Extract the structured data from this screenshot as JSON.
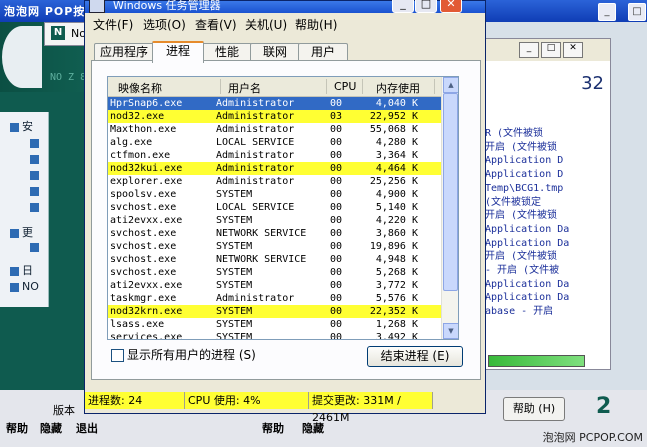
{
  "background": {
    "top_title": "泡泡网 POP按",
    "nod_window_title": "No",
    "left_items": [
      "安",
      "",
      "",
      "",
      "",
      "",
      "更",
      "",
      "日",
      "NO"
    ],
    "right_lines": [
      "R  (文件被锁",
      "开启 (文件被锁",
      "Application D",
      "Application D",
      "Temp\\BCG1.tmp",
      "(文件被锁定",
      "开启 (文件被锁",
      "Application Da",
      "Application Da",
      "开启 (文件被锁",
      "- 开启 (文件被",
      "Application Da",
      "Application Da",
      "abase - 开启"
    ],
    "right_number": "32",
    "version_label": "版本",
    "help_button": "帮助 (H)",
    "bottom_left_labels": [
      "帮助",
      "隐藏",
      "退出"
    ],
    "bottom_mid_labels": [
      "帮助",
      "隐藏"
    ],
    "watermark": "泡泡网 PCPOP.COM"
  },
  "taskmanager": {
    "title": "Windows 任务管理器",
    "menu": [
      "文件(F)",
      "选项(O)",
      "查看(V)",
      "关机(U)",
      "帮助(H)"
    ],
    "tabs": [
      "应用程序",
      "进程",
      "性能",
      "联网",
      "用户"
    ],
    "active_tab": "进程",
    "columns": [
      "映像名称",
      "用户名",
      "CPU",
      "内存使用"
    ],
    "processes": [
      {
        "name": "HprSnap6.exe",
        "user": "Administrator",
        "cpu": "00",
        "mem": "4,040 K",
        "state": "selected"
      },
      {
        "name": "nod32.exe",
        "user": "Administrator",
        "cpu": "03",
        "mem": "22,952 K",
        "state": "highlight"
      },
      {
        "name": "Maxthon.exe",
        "user": "Administrator",
        "cpu": "00",
        "mem": "55,068 K",
        "state": ""
      },
      {
        "name": "alg.exe",
        "user": "LOCAL SERVICE",
        "cpu": "00",
        "mem": "4,280 K",
        "state": ""
      },
      {
        "name": "ctfmon.exe",
        "user": "Administrator",
        "cpu": "00",
        "mem": "3,364 K",
        "state": ""
      },
      {
        "name": "nod32kui.exe",
        "user": "Administrator",
        "cpu": "00",
        "mem": "4,464 K",
        "state": "highlight"
      },
      {
        "name": "explorer.exe",
        "user": "Administrator",
        "cpu": "00",
        "mem": "25,256 K",
        "state": ""
      },
      {
        "name": "spoolsv.exe",
        "user": "SYSTEM",
        "cpu": "00",
        "mem": "4,900 K",
        "state": ""
      },
      {
        "name": "svchost.exe",
        "user": "LOCAL SERVICE",
        "cpu": "00",
        "mem": "5,140 K",
        "state": ""
      },
      {
        "name": "ati2evxx.exe",
        "user": "SYSTEM",
        "cpu": "00",
        "mem": "4,220 K",
        "state": ""
      },
      {
        "name": "svchost.exe",
        "user": "NETWORK SERVICE",
        "cpu": "00",
        "mem": "3,860 K",
        "state": ""
      },
      {
        "name": "svchost.exe",
        "user": "SYSTEM",
        "cpu": "00",
        "mem": "19,896 K",
        "state": ""
      },
      {
        "name": "svchost.exe",
        "user": "NETWORK SERVICE",
        "cpu": "00",
        "mem": "4,948 K",
        "state": ""
      },
      {
        "name": "svchost.exe",
        "user": "SYSTEM",
        "cpu": "00",
        "mem": "5,268 K",
        "state": ""
      },
      {
        "name": "ati2evxx.exe",
        "user": "SYSTEM",
        "cpu": "00",
        "mem": "3,772 K",
        "state": ""
      },
      {
        "name": "taskmgr.exe",
        "user": "Administrator",
        "cpu": "00",
        "mem": "5,576 K",
        "state": ""
      },
      {
        "name": "nod32krn.exe",
        "user": "SYSTEM",
        "cpu": "00",
        "mem": "22,352 K",
        "state": "highlight"
      },
      {
        "name": "lsass.exe",
        "user": "SYSTEM",
        "cpu": "00",
        "mem": "1,268 K",
        "state": ""
      },
      {
        "name": "services.exe",
        "user": "SYSTEM",
        "cpu": "00",
        "mem": "3,492 K",
        "state": ""
      }
    ],
    "show_all_users_label": "显示所有用户的进程 (S)",
    "show_all_users_checked": false,
    "end_process_button": "结束进程 (E)",
    "status": {
      "processes": "进程数: 24",
      "cpu": "CPU 使用: 4%",
      "commit": "提交更改: 331M / 2461M"
    },
    "highlight_color": "#ffff33",
    "selection_color": "#316ac5"
  }
}
